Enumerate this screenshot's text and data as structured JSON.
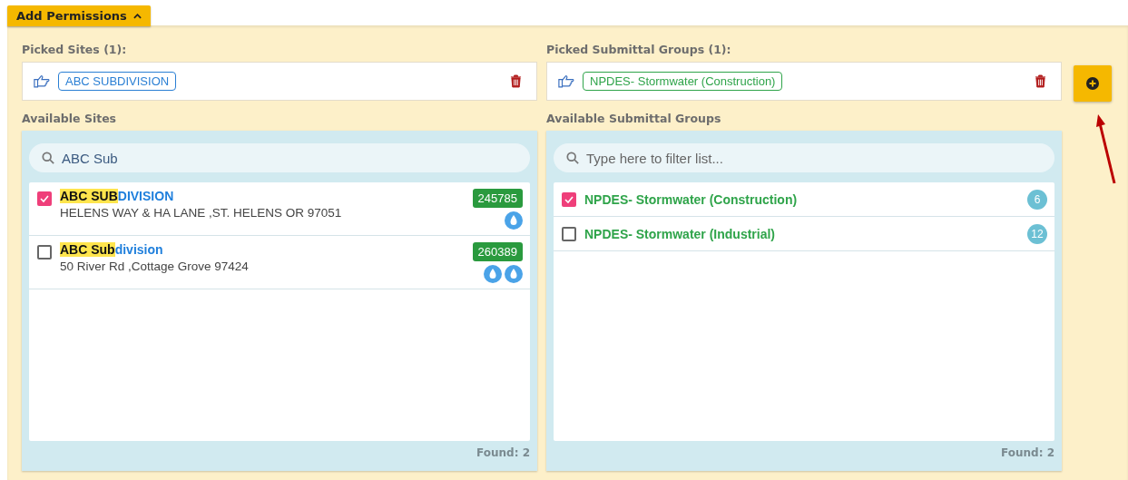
{
  "toggle": {
    "label": "Add Permissions",
    "expanded": true
  },
  "sites": {
    "picked_label": "Picked Sites (1):",
    "picked": [
      {
        "label": "ABC SUBDIVISION"
      }
    ],
    "available_label": "Available Sites",
    "search": {
      "value": "ABC Sub"
    },
    "items": [
      {
        "match": "ABC SUB",
        "rest": "DIVISION",
        "address": "HELENS WAY & HA LANE ,ST. HELENS OR 97051",
        "id": "245785",
        "checked": true,
        "icons": [
          {
            "kind": "drop"
          }
        ]
      },
      {
        "match": "ABC Sub",
        "rest": "division",
        "address": "50 River Rd ,Cottage Grove 97424",
        "id": "260389",
        "checked": false,
        "icons": [
          {
            "kind": "drop"
          },
          {
            "kind": "drop"
          }
        ]
      }
    ],
    "found": "Found: 2"
  },
  "groups": {
    "picked_label": "Picked Submittal Groups (1):",
    "picked": [
      {
        "label": "NPDES- Stormwater (Construction)"
      }
    ],
    "available_label": "Available Submittal Groups",
    "search": {
      "placeholder": "Type here to filter list..."
    },
    "items": [
      {
        "name": "NPDES- Stormwater (Construction)",
        "count": "6",
        "checked": true
      },
      {
        "name": "NPDES- Stormwater (Industrial)",
        "count": "12",
        "checked": false
      }
    ],
    "found": "Found: 2"
  }
}
